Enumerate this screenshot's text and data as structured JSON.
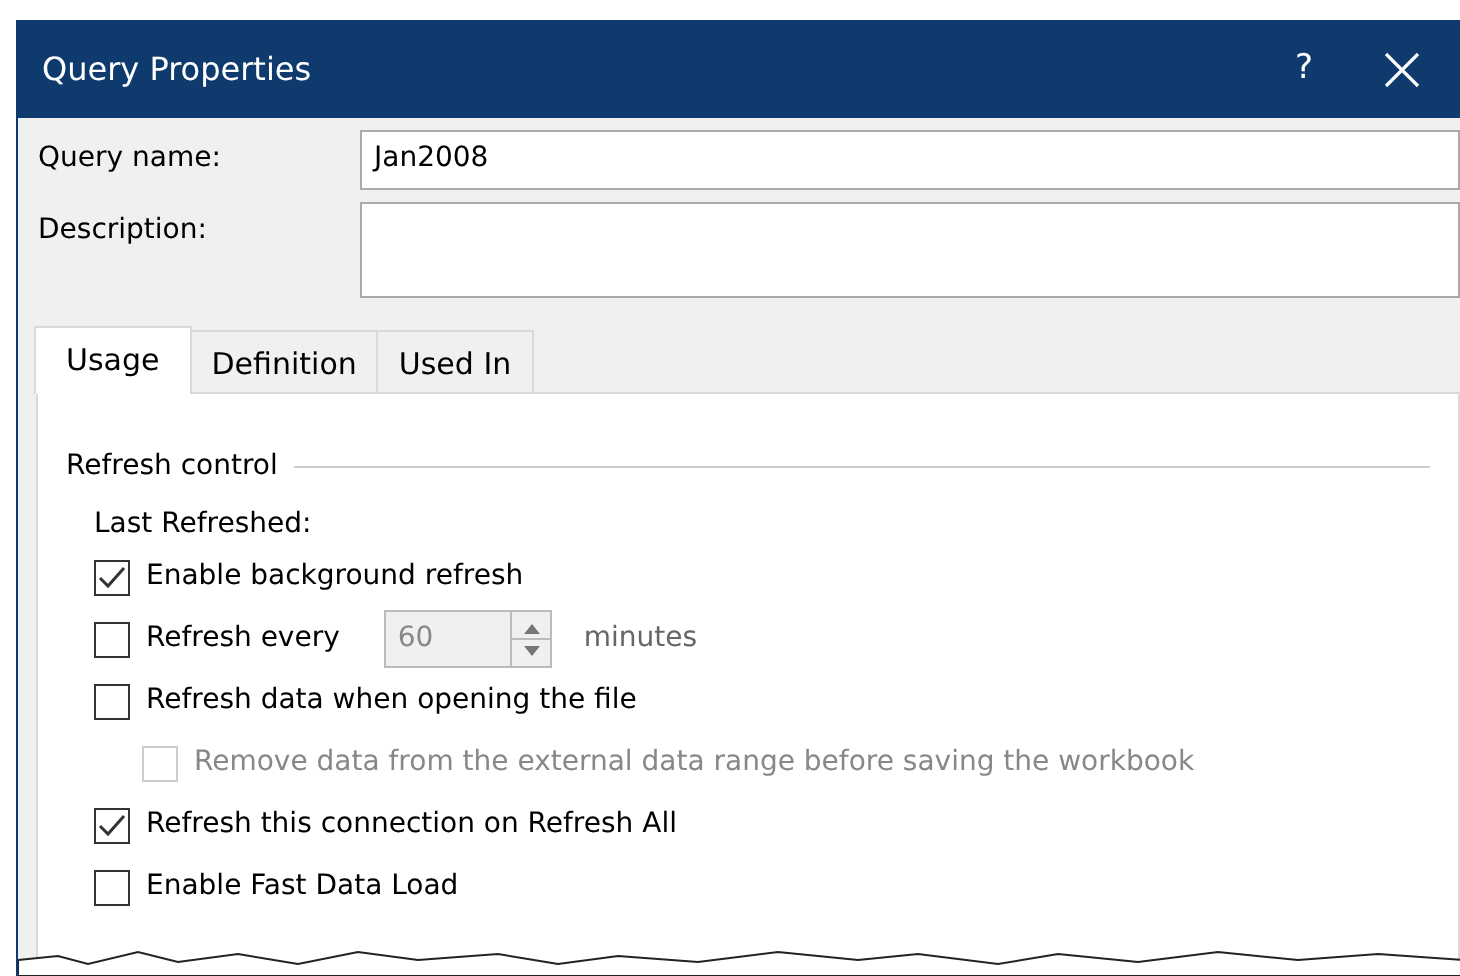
{
  "window": {
    "title": "Query Properties",
    "help": "?"
  },
  "fields": [
    {
      "label": "Query name:",
      "value": "Jan2008",
      "kind": "single"
    },
    {
      "label": "Description:",
      "kind": "multi"
    }
  ],
  "tabs": [
    {
      "label": "Usage",
      "selected": true
    },
    {
      "label": "Definition",
      "selected": false
    },
    {
      "label": "Used In",
      "selected": false
    }
  ],
  "refresh_control": {
    "title": "Refresh control",
    "last_refreshed": "Last Refreshed:",
    "options": [
      {
        "kind": "checkbox",
        "label": "Enable background refresh",
        "checked": true,
        "disabled": false
      },
      {
        "kind": "interval",
        "label": "Refresh every",
        "checked": false,
        "disabled": false,
        "value": "60",
        "value_disabled": true,
        "unit": "minutes"
      },
      {
        "kind": "checkbox",
        "label": "Refresh data when opening the file",
        "checked": false,
        "disabled": false,
        "children": [
          {
            "kind": "checkbox",
            "label": "Remove data from the external data range before saving the workbook",
            "checked": false,
            "disabled": true
          }
        ]
      },
      {
        "kind": "checkbox",
        "label": "Refresh this connection on Refresh All",
        "checked": true,
        "disabled": false
      },
      {
        "kind": "checkbox",
        "label": "Enable Fast Data Load",
        "checked": false,
        "disabled": false
      }
    ]
  }
}
